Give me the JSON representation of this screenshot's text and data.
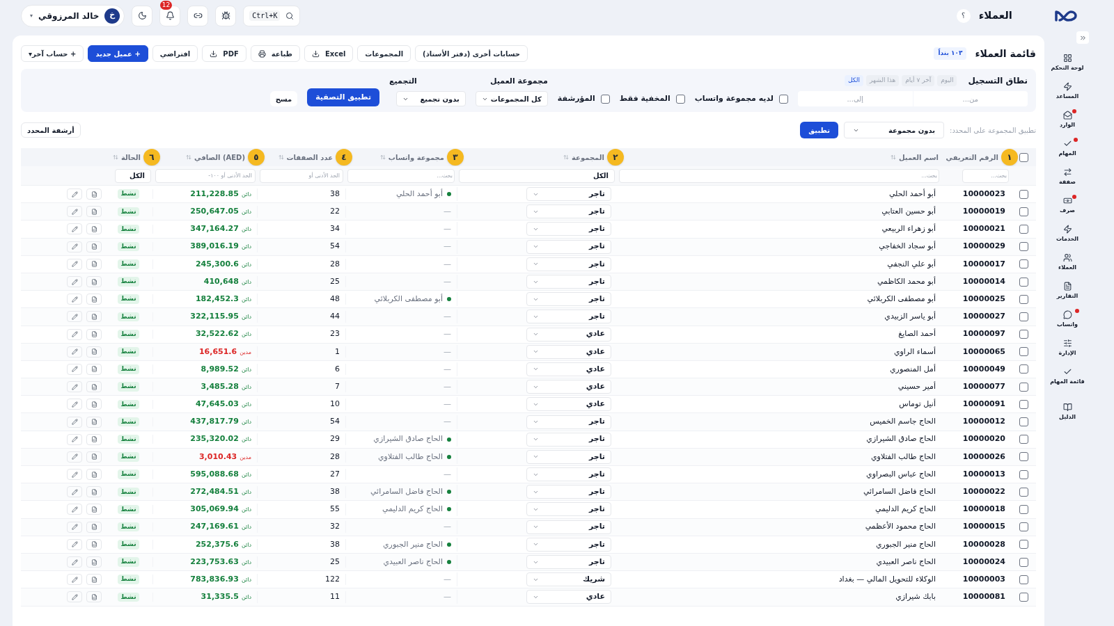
{
  "topbar": {
    "title": "العملاء",
    "help": "؟",
    "search_shortcut": "Ctrl+K",
    "notifications": "12",
    "user": {
      "name": "خالد المرزوقي",
      "initial": "خ",
      "caret": "▾"
    }
  },
  "sidebar": {
    "items": [
      {
        "label": "لوحة التحكم",
        "alert": false
      },
      {
        "label": "المساعد",
        "alert": false
      },
      {
        "label": "الوارد",
        "alert": true
      },
      {
        "label": "المهام",
        "alert": true
      },
      {
        "label": "صفقة",
        "alert": false
      },
      {
        "label": "صرف",
        "alert": true
      },
      {
        "label": "الخدمات",
        "alert": false
      },
      {
        "label": "العملاء",
        "alert": false
      },
      {
        "label": "التقارير",
        "alert": false
      },
      {
        "label": "واتساب",
        "alert": true
      },
      {
        "label": "الإدارة",
        "alert": false
      },
      {
        "label": "قائمة المهام",
        "alert": false
      },
      {
        "label": "الدليل",
        "alert": false
      }
    ]
  },
  "page": {
    "title": "قائمة العملاء",
    "count_badge": "١٠٣ بنداً",
    "actions": [
      {
        "label": "حسابات أخرى (دفتر الأستاذ)",
        "kind": "plain"
      },
      {
        "label": "المجموعات",
        "kind": "plain"
      },
      {
        "label": "Excel",
        "kind": "download"
      },
      {
        "label": "طباعة",
        "kind": "print"
      },
      {
        "label": "PDF",
        "kind": "download"
      },
      {
        "label": "افتراضي",
        "kind": "plain"
      },
      {
        "label": "+ عميل جديد",
        "kind": "primary"
      },
      {
        "label": "+ حساب آخر▾",
        "kind": "plain"
      }
    ]
  },
  "filters": {
    "range_label": "نطاق التسجيل",
    "range_chips": [
      {
        "label": "اليوم",
        "selected": false
      },
      {
        "label": "آخر ٧ أيام",
        "selected": false
      },
      {
        "label": "هذا الشهر",
        "selected": false
      },
      {
        "label": "الكل",
        "selected": true
      }
    ],
    "from_placeholder": "من...",
    "to_placeholder": "إلى...",
    "checkboxes": [
      {
        "label": "لديه مجموعة واتساب",
        "checked": false
      },
      {
        "label": "المخفية فقط",
        "checked": false
      },
      {
        "label": "المؤرشفة",
        "checked": false
      }
    ],
    "group_label": "مجموعة العميل",
    "group_value": "كل المجموعات",
    "grouping_label": "التجميع",
    "grouping_value": "بدون تجميع",
    "apply": "تطبيق التصفية",
    "clear": "مسح"
  },
  "bulk": {
    "label": "تطبيق المجموعة على المحدد:",
    "value": "بدون مجموعة",
    "apply": "تطبيق",
    "archive": "أرشفة المحدد"
  },
  "table": {
    "select_all_checked": false,
    "columns": [
      {
        "label": "الرقم التعريفي",
        "marker": "١"
      },
      {
        "label": "اسم العميل"
      },
      {
        "label": "المجموعة",
        "marker": "٢"
      },
      {
        "label": "مجموعة واتساب",
        "marker": "٣"
      },
      {
        "label": "عدد الصفقات",
        "marker": "٤"
      },
      {
        "label": "(AED) الصافي",
        "marker": "٥"
      },
      {
        "label": "الحالة",
        "marker": "٦"
      }
    ],
    "filter_row": [
      {
        "kind": "input",
        "placeholder": "بحث..."
      },
      {
        "kind": "input",
        "placeholder": "بحث..."
      },
      {
        "kind": "select",
        "value": "الكل"
      },
      {
        "kind": "input",
        "placeholder": "بحث..."
      },
      {
        "kind": "input",
        "placeholder": "الحد الأدنى أو"
      },
      {
        "kind": "input",
        "placeholder": "الحد الأدنى أو ١٠٠-"
      },
      {
        "kind": "select",
        "value": "الكل"
      }
    ],
    "rows": [
      {
        "checked": false,
        "id": "10000023",
        "name": "أبو أحمد الحلي",
        "group": "تاجر",
        "whatsapp": "أبو أحمد الحلي",
        "whatsapp_linked": true,
        "deals": "38",
        "balance_label": "دائن",
        "is_debit": false,
        "balance": "211,228.85",
        "status": "نشط"
      },
      {
        "checked": false,
        "id": "10000019",
        "name": "أبو حسين العتابي",
        "group": "تاجر",
        "whatsapp": "—",
        "whatsapp_linked": false,
        "deals": "22",
        "balance_label": "دائن",
        "is_debit": false,
        "balance": "250,647.05",
        "status": "نشط"
      },
      {
        "checked": false,
        "id": "10000021",
        "name": "أبو زهراء الربيعي",
        "group": "تاجر",
        "whatsapp": "—",
        "whatsapp_linked": false,
        "deals": "34",
        "balance_label": "دائن",
        "is_debit": false,
        "balance": "347,164.27",
        "status": "نشط"
      },
      {
        "checked": false,
        "id": "10000029",
        "name": "أبو سجاد الخفاجي",
        "group": "تاجر",
        "whatsapp": "—",
        "whatsapp_linked": false,
        "deals": "54",
        "balance_label": "دائن",
        "is_debit": false,
        "balance": "389,016.19",
        "status": "نشط"
      },
      {
        "checked": false,
        "id": "10000017",
        "name": "أبو علي النجفي",
        "group": "تاجر",
        "whatsapp": "—",
        "whatsapp_linked": false,
        "deals": "28",
        "balance_label": "دائن",
        "is_debit": false,
        "balance": "245,300.6",
        "status": "نشط"
      },
      {
        "checked": false,
        "id": "10000014",
        "name": "أبو محمد الكاظمي",
        "group": "تاجر",
        "whatsapp": "—",
        "whatsapp_linked": false,
        "deals": "25",
        "balance_label": "دائن",
        "is_debit": false,
        "balance": "410,648",
        "status": "نشط"
      },
      {
        "checked": false,
        "id": "10000025",
        "name": "أبو مصطفى الكربلائي",
        "group": "تاجر",
        "whatsapp": "أبو مصطفى الكربلائي",
        "whatsapp_linked": true,
        "deals": "48",
        "balance_label": "دائن",
        "is_debit": false,
        "balance": "182,452.3",
        "status": "نشط"
      },
      {
        "checked": false,
        "id": "10000027",
        "name": "أبو ياسر الزبيدي",
        "group": "تاجر",
        "whatsapp": "—",
        "whatsapp_linked": false,
        "deals": "44",
        "balance_label": "دائن",
        "is_debit": false,
        "balance": "322,115.95",
        "status": "نشط"
      },
      {
        "checked": false,
        "id": "10000097",
        "name": "أحمد الصايغ",
        "group": "عادي",
        "whatsapp": "—",
        "whatsapp_linked": false,
        "deals": "23",
        "balance_label": "دائن",
        "is_debit": false,
        "balance": "32,522.62",
        "status": "نشط"
      },
      {
        "checked": false,
        "id": "10000065",
        "name": "أسماء الراوي",
        "group": "عادي",
        "whatsapp": "—",
        "whatsapp_linked": false,
        "deals": "1",
        "balance_label": "مدين",
        "is_debit": true,
        "balance": "16,651.6",
        "status": "نشط"
      },
      {
        "checked": false,
        "id": "10000049",
        "name": "أمل المنصوري",
        "group": "عادي",
        "whatsapp": "—",
        "whatsapp_linked": false,
        "deals": "6",
        "balance_label": "دائن",
        "is_debit": false,
        "balance": "8,989.52",
        "status": "نشط"
      },
      {
        "checked": false,
        "id": "10000077",
        "name": "أمير حسيني",
        "group": "عادي",
        "whatsapp": "—",
        "whatsapp_linked": false,
        "deals": "7",
        "balance_label": "دائن",
        "is_debit": false,
        "balance": "3,485.28",
        "status": "نشط"
      },
      {
        "checked": false,
        "id": "10000091",
        "name": "أنيل توماس",
        "group": "عادي",
        "whatsapp": "—",
        "whatsapp_linked": false,
        "deals": "10",
        "balance_label": "دائن",
        "is_debit": false,
        "balance": "47,645.03",
        "status": "نشط"
      },
      {
        "checked": false,
        "id": "10000012",
        "name": "الحاج جاسم الخميس",
        "group": "تاجر",
        "whatsapp": "—",
        "whatsapp_linked": false,
        "deals": "54",
        "balance_label": "دائن",
        "is_debit": false,
        "balance": "437,817.79",
        "status": "نشط"
      },
      {
        "checked": false,
        "id": "10000020",
        "name": "الحاج صادق الشيرازي",
        "group": "تاجر",
        "whatsapp": "الحاج صادق الشيرازي",
        "whatsapp_linked": true,
        "deals": "29",
        "balance_label": "دائن",
        "is_debit": false,
        "balance": "235,320.02",
        "status": "نشط"
      },
      {
        "checked": false,
        "id": "10000026",
        "name": "الحاج طالب الفتلاوي",
        "group": "تاجر",
        "whatsapp": "الحاج طالب الفتلاوي",
        "whatsapp_linked": true,
        "deals": "28",
        "balance_label": "مدين",
        "is_debit": true,
        "balance": "3,010.43",
        "status": "نشط"
      },
      {
        "checked": false,
        "id": "10000013",
        "name": "الحاج عباس البصراوي",
        "group": "تاجر",
        "whatsapp": "—",
        "whatsapp_linked": false,
        "deals": "27",
        "balance_label": "دائن",
        "is_debit": false,
        "balance": "595,088.68",
        "status": "نشط"
      },
      {
        "checked": false,
        "id": "10000022",
        "name": "الحاج فاضل السامرائي",
        "group": "تاجر",
        "whatsapp": "الحاج فاضل السامرائي",
        "whatsapp_linked": true,
        "deals": "38",
        "balance_label": "دائن",
        "is_debit": false,
        "balance": "272,484.51",
        "status": "نشط"
      },
      {
        "checked": false,
        "id": "10000018",
        "name": "الحاج كريم الدليمي",
        "group": "تاجر",
        "whatsapp": "الحاج كريم الدليمي",
        "whatsapp_linked": true,
        "deals": "55",
        "balance_label": "دائن",
        "is_debit": false,
        "balance": "305,069.94",
        "status": "نشط"
      },
      {
        "checked": false,
        "id": "10000015",
        "name": "الحاج محمود الأعظمي",
        "group": "تاجر",
        "whatsapp": "—",
        "whatsapp_linked": false,
        "deals": "32",
        "balance_label": "دائن",
        "is_debit": false,
        "balance": "247,169.61",
        "status": "نشط"
      },
      {
        "checked": false,
        "id": "10000028",
        "name": "الحاج منير الجبوري",
        "group": "تاجر",
        "whatsapp": "الحاج منير الجبوري",
        "whatsapp_linked": true,
        "deals": "38",
        "balance_label": "دائن",
        "is_debit": false,
        "balance": "252,375.6",
        "status": "نشط"
      },
      {
        "checked": false,
        "id": "10000024",
        "name": "الحاج ناصر العبيدي",
        "group": "تاجر",
        "whatsapp": "الحاج ناصر العبيدي",
        "whatsapp_linked": true,
        "deals": "25",
        "balance_label": "دائن",
        "is_debit": false,
        "balance": "223,753.63",
        "status": "نشط"
      },
      {
        "checked": false,
        "id": "10000003",
        "name": "الوكلاء للتحويل المالي — بغداد",
        "group": "شريك",
        "whatsapp": "—",
        "whatsapp_linked": false,
        "deals": "122",
        "balance_label": "دائن",
        "is_debit": false,
        "balance": "783,836.93",
        "status": "نشط"
      },
      {
        "checked": false,
        "id": "10000081",
        "name": "بابك شيرازي",
        "group": "عادي",
        "whatsapp": "—",
        "whatsapp_linked": false,
        "deals": "11",
        "balance_label": "دائن",
        "is_debit": false,
        "balance": "31,335.5",
        "status": "نشط"
      }
    ]
  }
}
